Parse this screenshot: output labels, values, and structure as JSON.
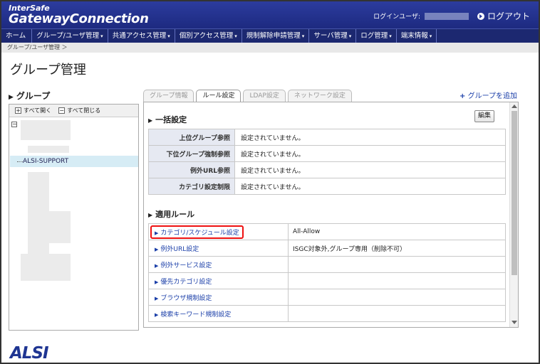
{
  "app": {
    "logo_line1": "InterSafe",
    "logo_line2": "GatewayConnection",
    "user_label": "ログインユーザ:",
    "logout": "ログアウト",
    "footer_logo": "ALSI"
  },
  "menu": [
    {
      "label": "ホーム",
      "caret": ""
    },
    {
      "label": "グループ/ユーザ管理",
      "caret": "▾"
    },
    {
      "label": "共通アクセス管理",
      "caret": "▾"
    },
    {
      "label": "個別アクセス管理",
      "caret": "▾"
    },
    {
      "label": "規制解除申請管理",
      "caret": "▾"
    },
    {
      "label": "サーバ管理",
      "caret": "▾"
    },
    {
      "label": "ログ管理",
      "caret": "▾"
    },
    {
      "label": "端末情報",
      "caret": "▾"
    }
  ],
  "breadcrumb": "グループ/ユーザ管理 ＞",
  "page_title": "グループ管理",
  "left": {
    "title": "グループ",
    "expand_all": "すべて開く",
    "collapse_all": "すべて閉じる",
    "selected_group": "ALSI-SUPPORT"
  },
  "tabs": [
    {
      "label": "グループ情報",
      "active": false
    },
    {
      "label": "ルール設定",
      "active": true
    },
    {
      "label": "LDAP設定",
      "active": false
    },
    {
      "label": "ネットワーク設定",
      "active": false
    }
  ],
  "add_group": "グループを追加",
  "bulk": {
    "title": "一括設定",
    "edit": "編集",
    "rows": [
      {
        "key": "上位グループ参照",
        "value": "設定されていません。"
      },
      {
        "key": "下位グループ強制参照",
        "value": "設定されていません。"
      },
      {
        "key": "例外URL参照",
        "value": "設定されていません。"
      },
      {
        "key": "カテゴリ設定制限",
        "value": "設定されていません。"
      }
    ]
  },
  "rules": {
    "title": "適用ルール",
    "rows": [
      {
        "label": "カテゴリ/スケジュール設定",
        "value": "All-Allow"
      },
      {
        "label": "例外URL設定",
        "value": "ISGC対象外,グループ専用（削除不可）"
      },
      {
        "label": "例外サービス設定",
        "value": ""
      },
      {
        "label": "優先カテゴリ設定",
        "value": ""
      },
      {
        "label": "ブラウザ規制設定",
        "value": ""
      },
      {
        "label": "検索キーワード規制設定",
        "value": ""
      }
    ]
  },
  "colors": {
    "header": "#2c3c9e",
    "menubar": "#1c2870",
    "link": "#1a3ea8",
    "highlight": "#e11111"
  }
}
